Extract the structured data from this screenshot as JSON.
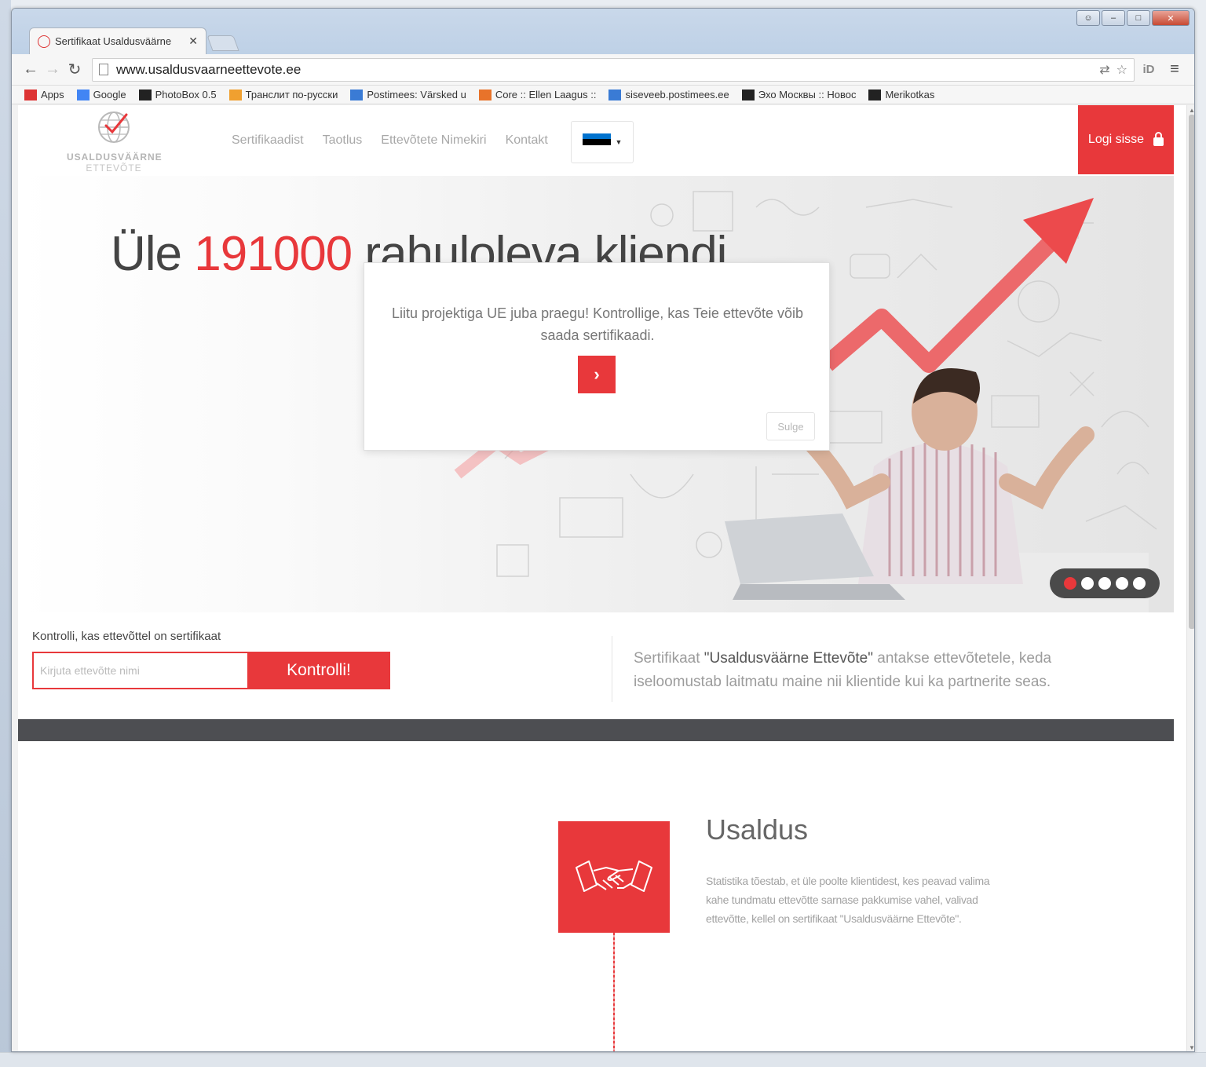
{
  "browser": {
    "tab_title": "Sertifikaat Usaldusväärne",
    "url": "www.usaldusvaarneettevote.ee",
    "bookmarks": [
      {
        "label": "Apps",
        "icon": "apps-grid-icon",
        "color": "#d33"
      },
      {
        "label": "Google",
        "icon": "google-icon",
        "color": "#4285f4"
      },
      {
        "label": "PhotoBox 0.5",
        "icon": "photobox-icon",
        "color": "#222"
      },
      {
        "label": "Транслит по-русски",
        "icon": "translit-icon",
        "color": "#f0a030"
      },
      {
        "label": "Postimees: Värsked u",
        "icon": "pm-icon",
        "color": "#3a7bd5"
      },
      {
        "label": "Core :: Ellen Laagus ::",
        "icon": "core-icon",
        "color": "#e8732a"
      },
      {
        "label": "siseveeb.postimees.ee",
        "icon": "pm-icon",
        "color": "#3a7bd5"
      },
      {
        "label": "Эхо Москвы :: Новос",
        "icon": "echo-icon",
        "color": "#222"
      },
      {
        "label": "Merikotkas",
        "icon": "eagle-icon",
        "color": "#222"
      }
    ]
  },
  "site": {
    "logo_line1": "USALDUSVÄÄRNE",
    "logo_line2": "ETTEVÕTE",
    "nav": [
      "Sertifikaadist",
      "Taotlus",
      "Ettevõtete Nimekiri",
      "Kontakt"
    ],
    "login_label": "Logi sisse",
    "accent": "#e8383b",
    "flag_colors": [
      "#0072ce",
      "#000000",
      "#ffffff"
    ]
  },
  "hero": {
    "title_prefix": "Üle ",
    "title_number": "191000",
    "title_suffix": " rahuloleva kliendi",
    "slides": 5,
    "active_slide": 1
  },
  "modal": {
    "text": "Liitu projektiga UE juba praegu! Kontrollige, kas Teie ettevõte võib saada sertifikaadi.",
    "go_symbol": "›",
    "close_label": "Sulge"
  },
  "check": {
    "label": "Kontrolli, kas ettevõttel on sertifikaat",
    "placeholder": "Kirjuta ettevõtte nimi",
    "button": "Kontrolli!"
  },
  "cert": {
    "prefix": "Sertifikaat ",
    "name": "\"Usaldusväärne Ettevõte\"",
    "suffix": " antakse ettevõtetele, keda iseloomustab laitmatu maine nii klientide kui ka partnerite seas."
  },
  "feature": {
    "title": "Usaldus",
    "text": "Statistika tõestab, et üle poolte klientidest, kes peavad valima kahe tundmatu ettevõtte sarnase pakkumise vahel, valivad ettevõtte, kellel on sertifikaat \"Usaldusväärne Ettevõte\".",
    "icon": "handshake-icon"
  }
}
